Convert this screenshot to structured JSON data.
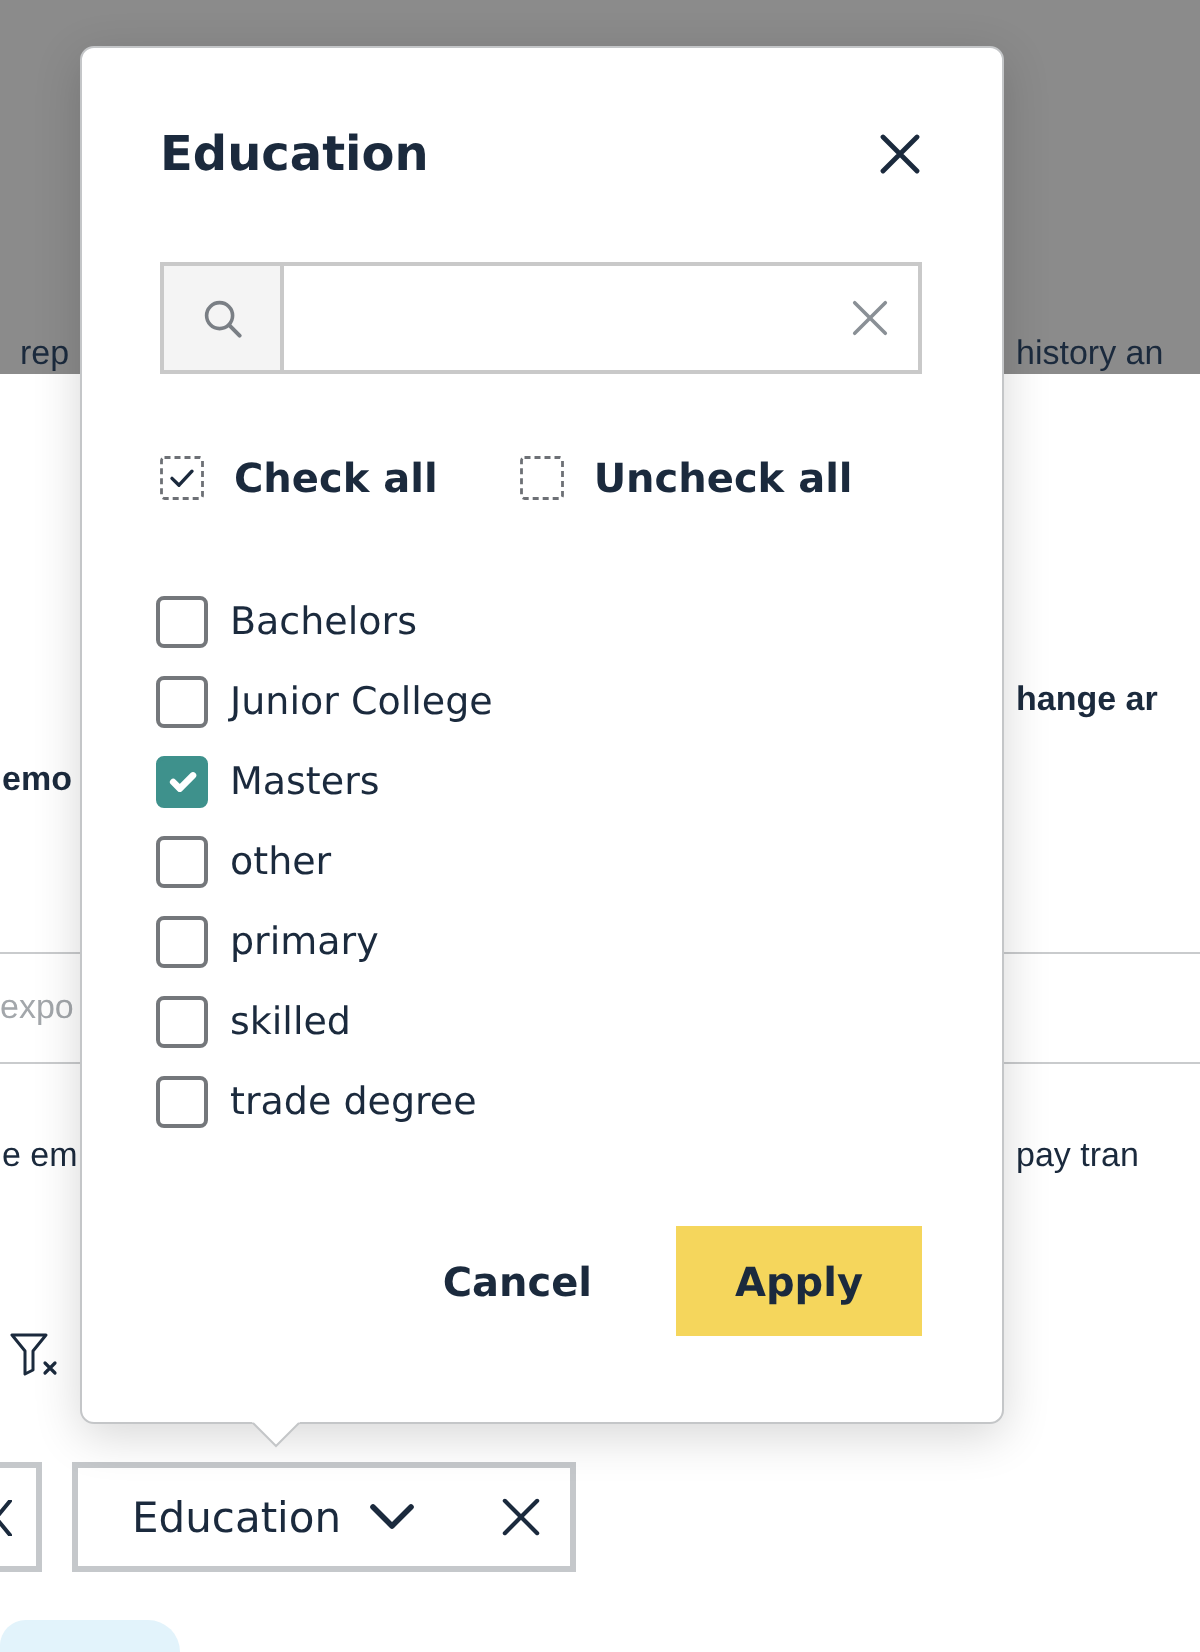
{
  "page": {
    "top_line": {
      "left": "rep",
      "right": "history an"
    },
    "heading_line": {
      "right": "hange ar"
    },
    "label_line": {
      "left": "emo"
    },
    "text_field": {
      "placeholder": "expo"
    },
    "text_line": {
      "left": "e em",
      "right": "pay tran"
    },
    "filter_chips": [
      {
        "kind": "cut"
      },
      {
        "kind": "dropdown",
        "label": "Education"
      }
    ]
  },
  "popover": {
    "title": "Education",
    "bulk_actions": [
      {
        "kind": "check",
        "label": "Check all"
      },
      {
        "kind": "uncheck",
        "label": "Uncheck all"
      }
    ],
    "options": [
      {
        "label": "Bachelors",
        "checked": false
      },
      {
        "label": "Junior College",
        "checked": false
      },
      {
        "label": "Masters",
        "checked": true
      },
      {
        "label": "other",
        "checked": false
      },
      {
        "label": "primary",
        "checked": false
      },
      {
        "label": "skilled",
        "checked": false
      },
      {
        "label": "trade degree",
        "checked": false
      }
    ],
    "buttons": [
      {
        "kind": "secondary",
        "label": "Cancel"
      },
      {
        "kind": "primary",
        "label": "Apply"
      }
    ]
  }
}
